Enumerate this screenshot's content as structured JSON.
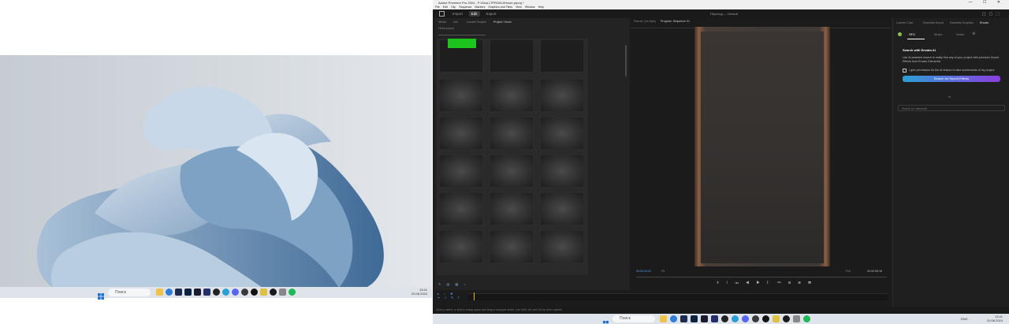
{
  "left_monitor": {
    "search_placeholder": "Поиск",
    "clock_time": "13:41",
    "clock_date": "20.08.2024"
  },
  "right_monitor": {
    "window_title": "Adobe Premiere Pro 2024 - F:\\Gina LTPRO\\DJ\\Hover.prproj *",
    "menu": [
      "File",
      "Edit",
      "Clip",
      "Sequence",
      "Markers",
      "Graphics and Titles",
      "View",
      "Window",
      "Help"
    ],
    "header_tabs": [
      "Import",
      "Edit",
      "Export"
    ],
    "header_active": "Edit",
    "workspace_label": "Переход — Default",
    "project_tabs": [
      "Media",
      "Info",
      "Lumetri Scopes",
      "Project: Hover"
    ],
    "project_active": "Project: Hover",
    "bin_label": "Hover.prproj",
    "source_tabs": [
      "Source: (no clips)",
      "Program: Sequence 01"
    ],
    "program_timecode_left": "00:00:24:22",
    "program_fit": "Fit",
    "program_quality": "Full",
    "program_timecode_right": "00:00:55:18",
    "essential_tabs": [
      "Lumetri Color",
      "Essential Sound",
      "Essential Graphics",
      "Envato"
    ],
    "essential_active": "Envato",
    "envato_tabs": [
      "SFX",
      "Music",
      "Video"
    ],
    "envato_active": "SFX",
    "envato_heading": "Search with Envato AI",
    "envato_desc": "Use AI-assisted search to easily find any of your project with premium Sound Effects from Envato Elements!",
    "envato_checkbox": "I give permission for the AI feature to take screenshots of my project.",
    "envato_button": "Search for Sound Effects",
    "envato_or": "or",
    "envato_search_placeholder": "Search for elements",
    "status_text": "Click to select, or click in empty space and drag to marquee select. Use Shift, Alt, and Ctrl for other options.",
    "search_placeholder": "Поиск",
    "clock_time": "13:41",
    "clock_date": "20.08.2024",
    "lang": "ENG"
  }
}
